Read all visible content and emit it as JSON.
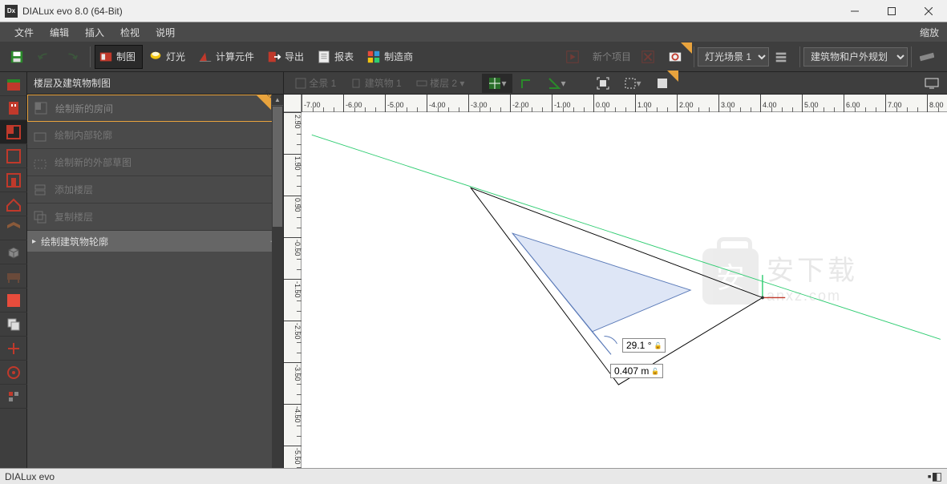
{
  "window": {
    "title": "DIALux evo 8.0  (64-Bit)",
    "logo": "Dx"
  },
  "menu": {
    "items": [
      "文件",
      "编辑",
      "插入",
      "检视",
      "说明"
    ],
    "right": "缩放"
  },
  "toolbar": {
    "tabs": [
      {
        "label": "制图",
        "color": "#c0392b",
        "active": true
      },
      {
        "label": "灯光",
        "color": "#f1c40f"
      },
      {
        "label": "计算元件",
        "color": "#e74c3c"
      },
      {
        "label": "导出",
        "color": "#c0392b"
      },
      {
        "label": "报表",
        "color": "#8e8e8e"
      },
      {
        "label": "制造商",
        "color": "multi"
      }
    ],
    "scene_select": "灯光场景 1",
    "mode_select": "建筑物和户外规划",
    "disabled_label": "新个项目"
  },
  "sidebar": {
    "header": "楼层及建筑物制图",
    "items": [
      {
        "label": "绘制新的房间",
        "active": true,
        "new": true
      },
      {
        "label": "绘制内部轮廓"
      },
      {
        "label": "绘制新的外部草图"
      },
      {
        "label": "添加楼层"
      },
      {
        "label": "复制楼层"
      }
    ],
    "section2": "绘制建筑物轮廓"
  },
  "canvas_tabs": {
    "items": [
      {
        "label": "全景 1",
        "dim": true
      },
      {
        "label": "建筑物 1",
        "dim": true
      },
      {
        "label": "楼层 2",
        "dim": true,
        "dd": true
      }
    ]
  },
  "rulers": {
    "h": [
      "-7.00",
      "-6.00",
      "-5.00",
      "-4.00",
      "-3.00",
      "-2.00",
      "-1.00",
      "0.00",
      "1.00",
      "2.00",
      "3.00",
      "4.00",
      "5.00",
      "6.00",
      "7.00",
      "8.00"
    ],
    "v": [
      "2.50",
      "1.50",
      "0.50",
      "-0.50",
      "-1.50",
      "-2.50",
      "-3.50",
      "-4.50",
      "-5.50"
    ]
  },
  "measurements": {
    "angle": "29.1 °",
    "length": "0.407 m"
  },
  "status": {
    "left": "DIALux evo"
  },
  "watermark": {
    "t1": "安下载",
    "t2": "anxz.com"
  }
}
